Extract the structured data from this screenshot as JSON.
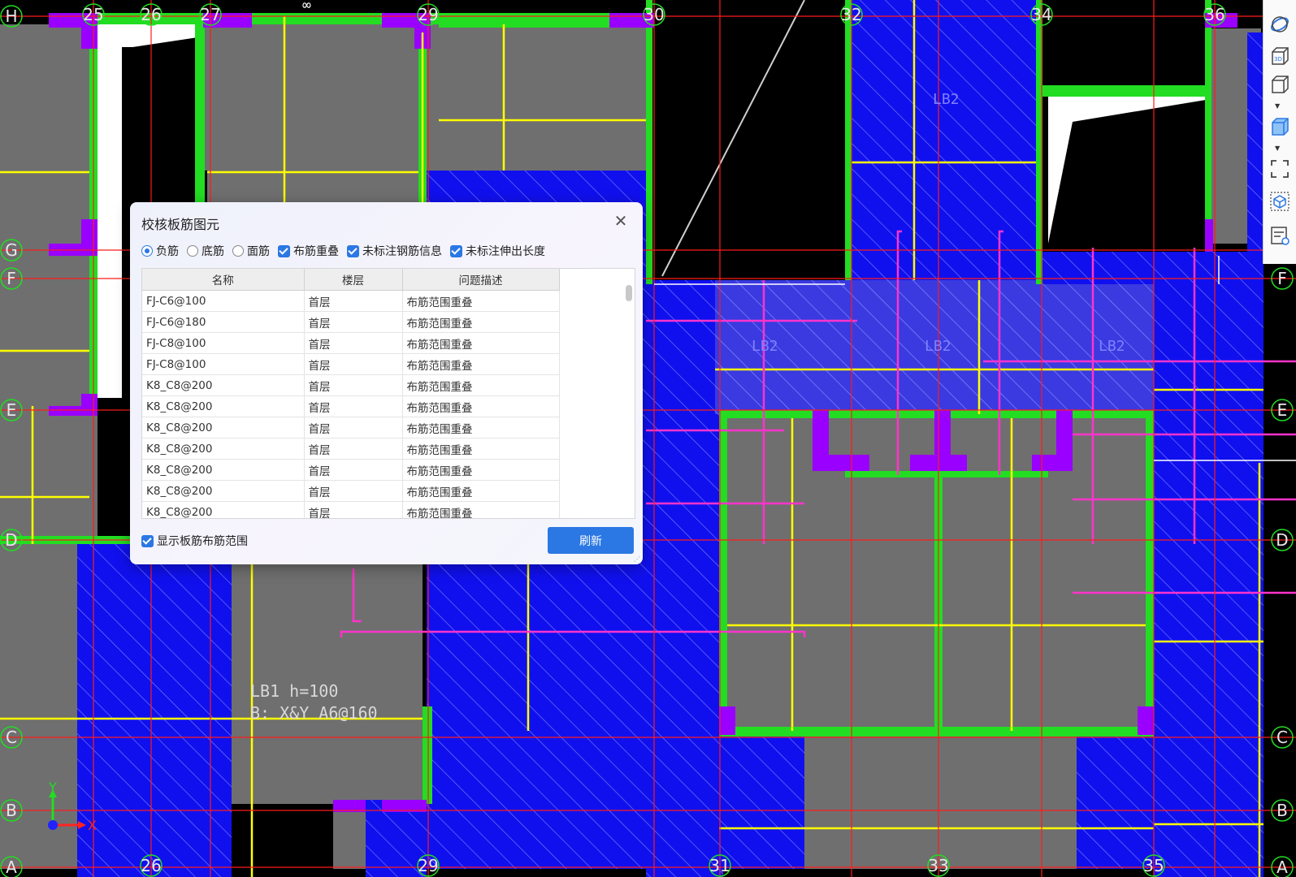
{
  "axes": {
    "top": [
      "25",
      "26",
      "27",
      "29",
      "30",
      "32",
      "34",
      "36"
    ],
    "bottom": [
      "26",
      "29",
      "31",
      "33",
      "35"
    ],
    "left": [
      "H",
      "G",
      "F",
      "E",
      "D",
      "C",
      "B",
      "A"
    ],
    "right": [
      "F",
      "E",
      "D",
      "C",
      "B",
      "A"
    ]
  },
  "annotations": {
    "slab_label_line1": "LB1  h=100",
    "slab_label_line2": "B: X&Y A6@160",
    "lb2_a": "LB2",
    "lb2_b": "LB2",
    "lb2_c": "LB2",
    "lb2_d": "LB2",
    "axis_y": "Y",
    "axis_x": "X",
    "infinity": "∞"
  },
  "dialog": {
    "title": "校核板筋图元",
    "options": {
      "negative": "负筋",
      "bottom": "底筋",
      "top": "面筋",
      "overlap": "布筋重叠",
      "no_rebar_info": "未标注钢筋信息",
      "no_extension": "未标注伸出长度"
    },
    "selected_radio": "负筋",
    "columns": [
      "名称",
      "楼层",
      "问题描述"
    ],
    "rows": [
      {
        "name": "FJ-C6@100",
        "floor": "首层",
        "desc": "布筋范围重叠"
      },
      {
        "name": "FJ-C6@180",
        "floor": "首层",
        "desc": "布筋范围重叠"
      },
      {
        "name": "FJ-C8@100",
        "floor": "首层",
        "desc": "布筋范围重叠"
      },
      {
        "name": "FJ-C8@100",
        "floor": "首层",
        "desc": "布筋范围重叠"
      },
      {
        "name": "K8_C8@200",
        "floor": "首层",
        "desc": "布筋范围重叠"
      },
      {
        "name": "K8_C8@200",
        "floor": "首层",
        "desc": "布筋范围重叠"
      },
      {
        "name": "K8_C8@200",
        "floor": "首层",
        "desc": "布筋范围重叠"
      },
      {
        "name": "K8_C8@200",
        "floor": "首层",
        "desc": "布筋范围重叠"
      },
      {
        "name": "K8_C8@200",
        "floor": "首层",
        "desc": "布筋范围重叠"
      },
      {
        "name": "K8_C8@200",
        "floor": "首层",
        "desc": "布筋范围重叠"
      },
      {
        "name": "K8_C8@200",
        "floor": "首层",
        "desc": "布筋范围重叠"
      }
    ],
    "show_range_label": "显示板筋布筋范围",
    "refresh_label": "刷新"
  },
  "toolbar": {
    "items": [
      "orbit-icon",
      "3d-view-icon",
      "cube-view-icon",
      "solid-cube-icon",
      "zoom-extents-icon",
      "model-box-icon",
      "layer-settings-icon"
    ]
  },
  "colors": {
    "slab_blue": "#1010ee",
    "slab_gray": "#6f6f6f",
    "beam_green": "#22dd22",
    "column_purple": "#9900ff",
    "grid_red": "#ff1a1a",
    "rebar_yellow": "#ffff00",
    "rebar_magenta": "#ff33cc",
    "accent_blue": "#2b78e4"
  }
}
